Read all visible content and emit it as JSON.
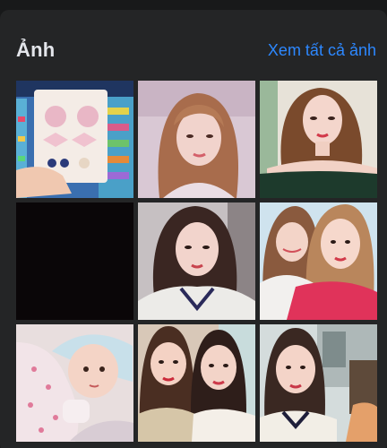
{
  "photos_section": {
    "title": "Ảnh",
    "see_all_label": "Xem tất cả ảnh",
    "accent_color": "#2d88ff"
  },
  "photos": [
    {
      "name": "photo-hair-clips-product"
    },
    {
      "name": "photo-selfie-woman-1"
    },
    {
      "name": "photo-woman-off-shoulder"
    },
    {
      "name": "photo-black"
    },
    {
      "name": "photo-woman-sweater"
    },
    {
      "name": "photo-two-women-red"
    },
    {
      "name": "photo-baby"
    },
    {
      "name": "photo-two-women-selfie"
    },
    {
      "name": "photo-woman-shop"
    }
  ]
}
